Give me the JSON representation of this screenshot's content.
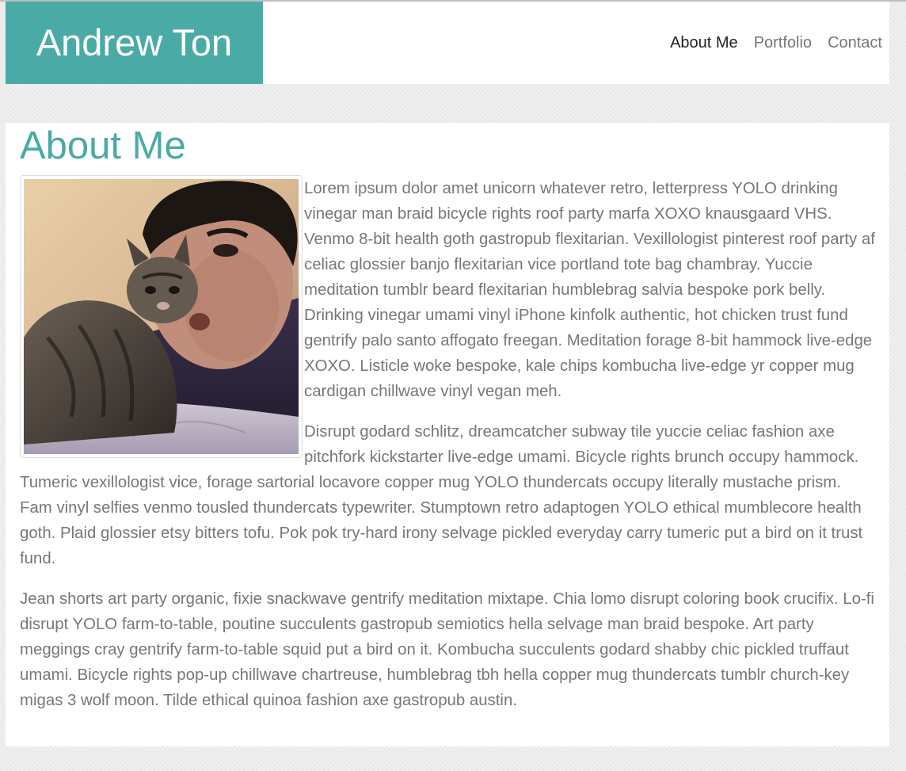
{
  "header": {
    "brand": "Andrew Ton",
    "nav": [
      {
        "label": "About Me",
        "active": true
      },
      {
        "label": "Portfolio",
        "active": false
      },
      {
        "label": "Contact",
        "active": false
      }
    ]
  },
  "main": {
    "title": "About Me",
    "photo_alt": "Andrew Ton with a kitten",
    "paragraphs": [
      "Lorem ipsum dolor amet unicorn whatever retro, letterpress YOLO drinking vinegar man braid bicycle rights roof party marfa XOXO knausgaard VHS. Venmo 8-bit health goth gastropub flexitarian. Vexillologist pinterest roof party af celiac glossier banjo flexitarian vice portland tote bag chambray. Yuccie meditation tumblr beard flexitarian humblebrag salvia bespoke pork belly. Drinking vinegar umami vinyl iPhone kinfolk authentic, hot chicken trust fund gentrify palo santo affogato freegan. Meditation forage 8-bit hammock live-edge XOXO. Listicle woke bespoke, kale chips kombucha live-edge yr copper mug cardigan chillwave vinyl vegan meh.",
      "Disrupt godard schlitz, dreamcatcher subway tile yuccie celiac fashion axe pitchfork kickstarter live-edge umami. Bicycle rights brunch occupy hammock. Tumeric vexillologist vice, forage sartorial locavore copper mug YOLO thundercats occupy literally mustache prism. Fam vinyl selfies venmo tousled thundercats typewriter. Stumptown retro adaptogen YOLO ethical mumblecore health goth. Plaid glossier etsy bitters tofu. Pok pok try-hard irony selvage pickled everyday carry tumeric put a bird on it trust fund.",
      "Jean shorts art party organic, fixie snackwave gentrify meditation mixtape. Chia lomo disrupt coloring book crucifix. Lo-fi disrupt YOLO farm-to-table, poutine succulents gastropub semiotics hella selvage man braid bespoke. Art party meggings cray gentrify farm-to-table squid put a bird on it. Kombucha succulents godard shabby chic pickled truffaut umami. Bicycle rights pop-up chillwave chartreuse, humblebrag tbh hella copper mug thundercats tumblr church-key migas 3 wolf moon. Tilde ethical quinoa fashion axe gastropub austin."
    ]
  },
  "colors": {
    "accent": "#4aaba6",
    "text": "#777777",
    "nav_active": "#222222",
    "background": "#ececec"
  }
}
